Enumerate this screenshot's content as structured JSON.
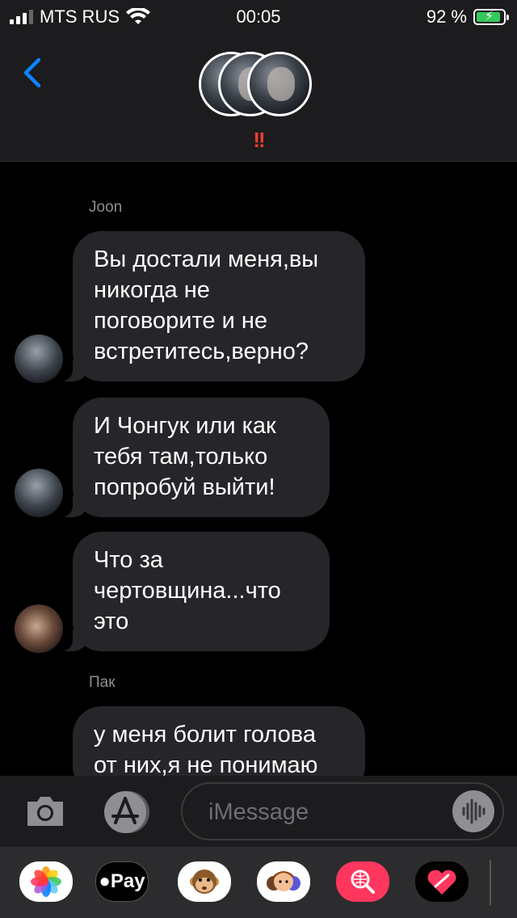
{
  "status_bar": {
    "carrier": "MTS RUS",
    "time": "00:05",
    "battery": "92 %",
    "battery_level": 0.92
  },
  "header": {
    "alert_marks": "!!",
    "icons": [
      "back-chevron-icon",
      "group-avatar-stack",
      "alert-icon"
    ]
  },
  "messages": [
    {
      "sender": "Joon",
      "text": "Вы достали меня,вы\nникогда не\nпоговорите и не\nвстретитесь,верно?"
    },
    {
      "sender": "",
      "text": "И Чонгук или как\nтебя там,только\nпопробуй выйти!"
    },
    {
      "sender": "",
      "text": "Что за\nчертовщина...что\nэто"
    },
    {
      "sender": "Пак",
      "text": "у меня болит голова\nот них,я не понимаю"
    }
  ],
  "input_bar": {
    "placeholder": "iMessage",
    "icons": [
      "camera-icon",
      "app-store-icon",
      "audio-waveform-icon"
    ]
  },
  "app_drawer": {
    "apple_pay_label": "Pay",
    "apps": [
      "photos",
      "apple-pay",
      "animoji",
      "memoji",
      "image-search",
      "digital-touch"
    ],
    "colors": {
      "image_search": "#ff375f",
      "photos_bg": "#ffffff"
    }
  },
  "colors": {
    "accent": "#0a84ff",
    "bubble": "#26262a",
    "alert": "#ff3b30",
    "battery": "#34c759",
    "background": "#000000"
  }
}
